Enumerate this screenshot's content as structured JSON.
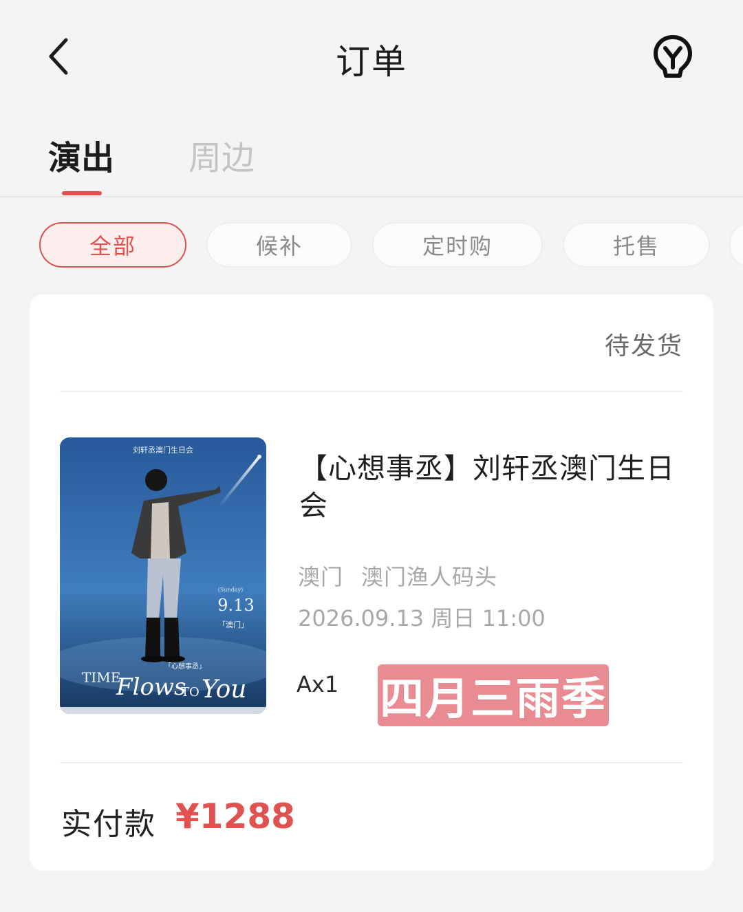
{
  "header": {
    "title": "订单",
    "back_icon": "chevron-left-icon",
    "service_icon": "customer-service-icon"
  },
  "tabs": [
    {
      "label": "演出",
      "active": true
    },
    {
      "label": "周边",
      "active": false
    }
  ],
  "filters": [
    {
      "label": "全部",
      "active": true
    },
    {
      "label": "候补",
      "active": false
    },
    {
      "label": "定时购",
      "active": false
    },
    {
      "label": "托售",
      "active": false
    }
  ],
  "order": {
    "status": "待发货",
    "title": "【心想事丞】刘轩丞澳门生日会",
    "city": "澳门",
    "venue": "澳门渔人码头",
    "datetime": "2026.09.13 周日 11:00",
    "quantity": "Ax1",
    "paid_label": "实付款",
    "paid_amount": "¥1288",
    "poster": {
      "top_text": "刘轩丞澳门生日会",
      "weekday": "(Sunday)",
      "date": "9.13",
      "location": "「澳门」",
      "subtitle": "「心想事丞」",
      "script_line1": "TIME",
      "script_line2": "Flows",
      "script_line3": "TO",
      "script_line4": "You"
    }
  },
  "watermark": "四月三雨季",
  "colors": {
    "accent": "#e0524f",
    "watermark_bg": "#e98b93"
  }
}
